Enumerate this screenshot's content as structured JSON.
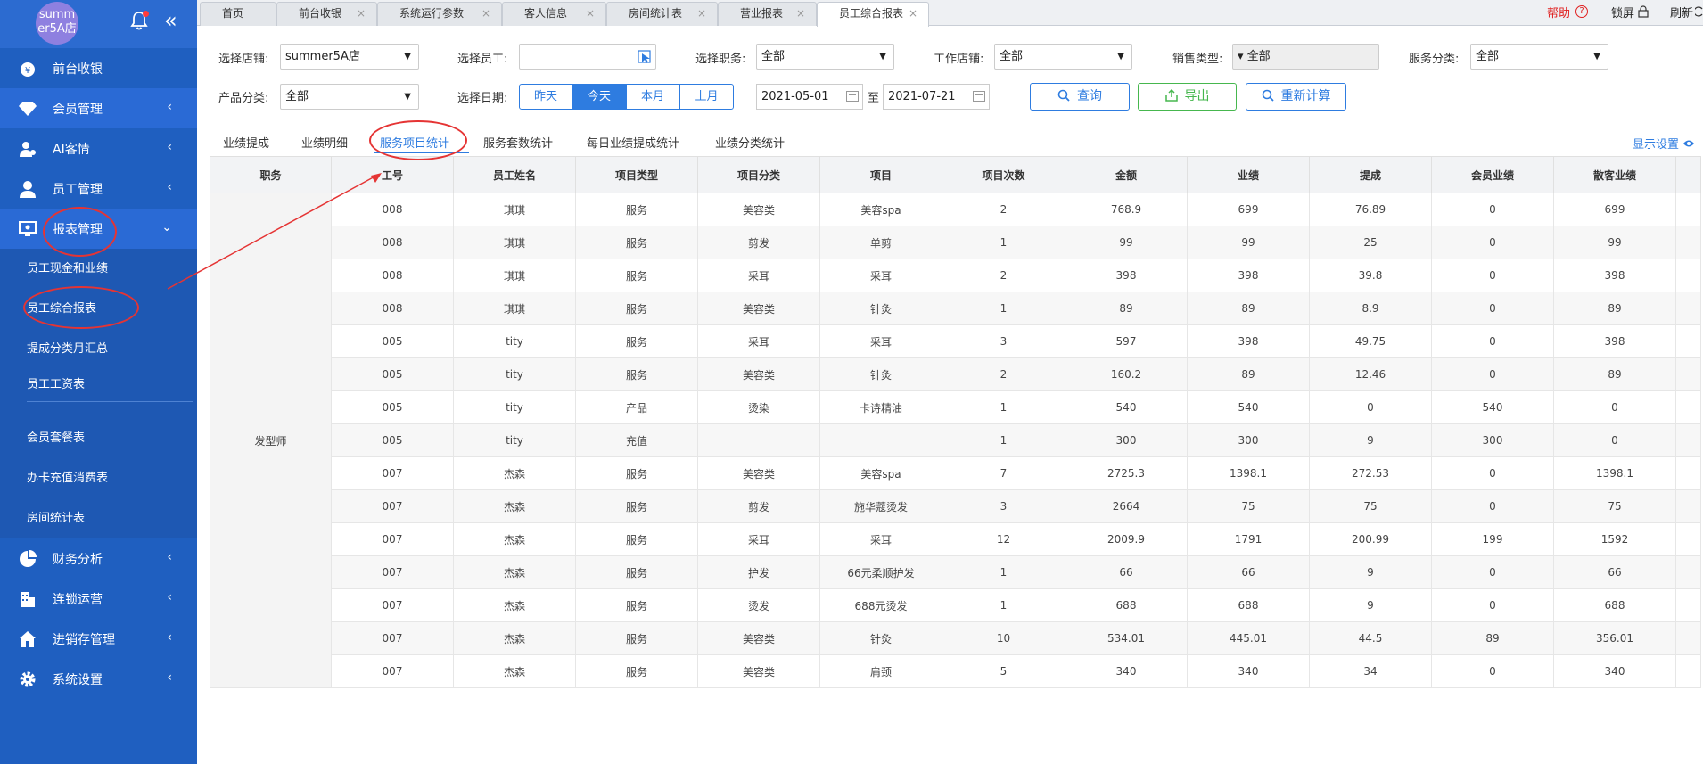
{
  "store": {
    "logo_text": "summer5A店"
  },
  "sidebar": {
    "items": [
      {
        "label": "前台收银",
        "icon": "money-bag-icon",
        "has_arrow": false
      },
      {
        "label": "会员管理",
        "icon": "diamond-icon",
        "has_arrow": true
      },
      {
        "label": "AI客情",
        "icon": "user-chat-icon",
        "has_arrow": true
      },
      {
        "label": "员工管理",
        "icon": "user-icon",
        "has_arrow": true
      },
      {
        "label": "报表管理",
        "icon": "monitor-icon",
        "expanded": true
      }
    ],
    "submenu": [
      "员工现金和业绩",
      "员工综合报表",
      "提成分类月汇总",
      "员工工资表",
      "会员套餐表",
      "办卡充值消费表",
      "房间统计表"
    ],
    "items_bottom": [
      {
        "label": "财务分析",
        "icon": "pie-chart-icon"
      },
      {
        "label": "连锁运营",
        "icon": "building-icon"
      },
      {
        "label": "进销存管理",
        "icon": "home-store-icon"
      },
      {
        "label": "系统设置",
        "icon": "gear-icon"
      }
    ]
  },
  "tabs": [
    {
      "label": "首页",
      "closable": false
    },
    {
      "label": "前台收银",
      "closable": true
    },
    {
      "label": "系统运行参数",
      "closable": true
    },
    {
      "label": "客人信息",
      "closable": true
    },
    {
      "label": "房间统计表",
      "closable": true
    },
    {
      "label": "营业报表",
      "closable": true
    },
    {
      "label": "员工综合报表",
      "closable": true,
      "active": true
    }
  ],
  "topbar": {
    "help": "帮助",
    "help_q": "?",
    "lock": "锁屏",
    "refresh": "刷新"
  },
  "filters": {
    "store_label": "选择店铺:",
    "store_value": "summer5A店",
    "employee_label": "选择员工:",
    "employee_value": "",
    "position_label": "选择职务:",
    "position_value": "全部",
    "work_store_label": "工作店铺:",
    "work_store_value": "全部",
    "sales_type_label": "销售类型:",
    "sales_type_value": "▾ 全部",
    "service_cat_label": "服务分类:",
    "service_cat_value": "全部",
    "product_cat_label": "产品分类:",
    "product_cat_value": "全部",
    "date_label": "选择日期:",
    "date_buttons": [
      "昨天",
      "今天",
      "本月",
      "上月"
    ],
    "date_from": "2021-05-01",
    "date_sep": "至",
    "date_to": "2021-07-21",
    "query_btn": "查询",
    "export_btn": "导出",
    "recalc_btn": "重新计算"
  },
  "subtabs": [
    "业绩提成",
    "业绩明细",
    "服务项目统计",
    "服务套数统计",
    "每日业绩提成统计",
    "业绩分类统计"
  ],
  "show_settings": "显示设置",
  "table": {
    "headers": [
      "职务",
      "工号",
      "员工姓名",
      "项目类型",
      "项目分类",
      "项目",
      "项目次数",
      "金额",
      "业绩",
      "提成",
      "会员业绩",
      "散客业绩"
    ],
    "role": "发型师",
    "rows": [
      [
        "008",
        "琪琪",
        "服务",
        "美容类",
        "美容spa",
        "2",
        "768.9",
        "699",
        "76.89",
        "0",
        "699"
      ],
      [
        "008",
        "琪琪",
        "服务",
        "剪发",
        "单剪",
        "1",
        "99",
        "99",
        "25",
        "0",
        "99"
      ],
      [
        "008",
        "琪琪",
        "服务",
        "采耳",
        "采耳",
        "2",
        "398",
        "398",
        "39.8",
        "0",
        "398"
      ],
      [
        "008",
        "琪琪",
        "服务",
        "美容类",
        "针灸",
        "1",
        "89",
        "89",
        "8.9",
        "0",
        "89"
      ],
      [
        "005",
        "tity",
        "服务",
        "采耳",
        "采耳",
        "3",
        "597",
        "398",
        "49.75",
        "0",
        "398"
      ],
      [
        "005",
        "tity",
        "服务",
        "美容类",
        "针灸",
        "2",
        "160.2",
        "89",
        "12.46",
        "0",
        "89"
      ],
      [
        "005",
        "tity",
        "产品",
        "烫染",
        "卡诗精油",
        "1",
        "540",
        "540",
        "0",
        "540",
        "0"
      ],
      [
        "005",
        "tity",
        "充值",
        "",
        "",
        "1",
        "300",
        "300",
        "9",
        "300",
        "0"
      ],
      [
        "007",
        "杰森",
        "服务",
        "美容类",
        "美容spa",
        "7",
        "2725.3",
        "1398.1",
        "272.53",
        "0",
        "1398.1"
      ],
      [
        "007",
        "杰森",
        "服务",
        "剪发",
        "施华蔻烫发",
        "3",
        "2664",
        "75",
        "75",
        "0",
        "75"
      ],
      [
        "007",
        "杰森",
        "服务",
        "采耳",
        "采耳",
        "12",
        "2009.9",
        "1791",
        "200.99",
        "199",
        "1592"
      ],
      [
        "007",
        "杰森",
        "服务",
        "护发",
        "66元柔顺护发",
        "1",
        "66",
        "66",
        "9",
        "0",
        "66"
      ],
      [
        "007",
        "杰森",
        "服务",
        "烫发",
        "688元烫发",
        "1",
        "688",
        "688",
        "9",
        "0",
        "688"
      ],
      [
        "007",
        "杰森",
        "服务",
        "美容类",
        "针灸",
        "10",
        "534.01",
        "445.01",
        "44.5",
        "89",
        "356.01"
      ],
      [
        "007",
        "杰森",
        "服务",
        "美容类",
        "肩颈",
        "5",
        "340",
        "340",
        "34",
        "0",
        "340"
      ]
    ]
  },
  "colors": {
    "sidebar_bg": "#1f5fc0",
    "accent": "#2e7ce0",
    "annotation_red": "#e53434",
    "export_green": "#46b74e"
  }
}
